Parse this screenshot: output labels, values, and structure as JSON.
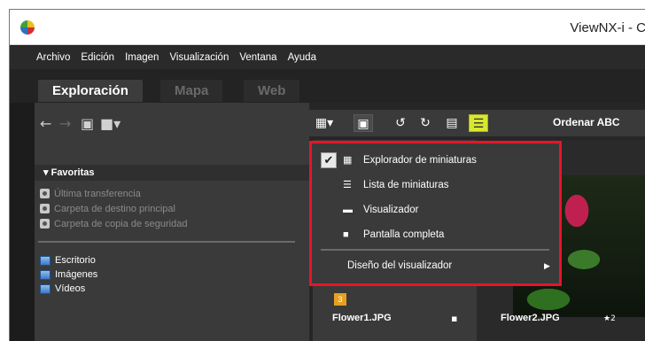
{
  "window": {
    "title": "ViewNX-i - C"
  },
  "menubar": {
    "items": [
      "Archivo",
      "Edición",
      "Imagen",
      "Visualización",
      "Ventana",
      "Ayuda"
    ]
  },
  "tabs": {
    "exploracion": "Exploración",
    "mapa": "Mapa",
    "web": "Web"
  },
  "left_panel": {
    "favorites_header": "Favoritas",
    "favorites": [
      "Última transferencia",
      "Carpeta de destino principal",
      "Carpeta de copia de seguridad"
    ],
    "places": [
      "Escritorio",
      "Imágenes",
      "Vídeos"
    ]
  },
  "toolbar": {
    "sort_label": "Ordenar ABC"
  },
  "dropdown": {
    "items": [
      {
        "label": "Explorador de miniaturas",
        "checked": true,
        "icon": "grid-icon"
      },
      {
        "label": "Lista de miniaturas",
        "checked": false,
        "icon": "list-icon"
      },
      {
        "label": "Visualizador",
        "checked": false,
        "icon": "viewer-icon"
      },
      {
        "label": "Pantalla completa",
        "checked": false,
        "icon": "fullscreen-icon"
      }
    ],
    "submenu_label": "Diseño del visualizador"
  },
  "thumbnails": [
    {
      "filename": "Flower1.JPG",
      "badge": "3"
    },
    {
      "filename": "Flower2.JPG",
      "rating": "★2"
    }
  ],
  "colors": {
    "highlight_border": "#e8142a",
    "tab_active": "#3c3c3c"
  }
}
